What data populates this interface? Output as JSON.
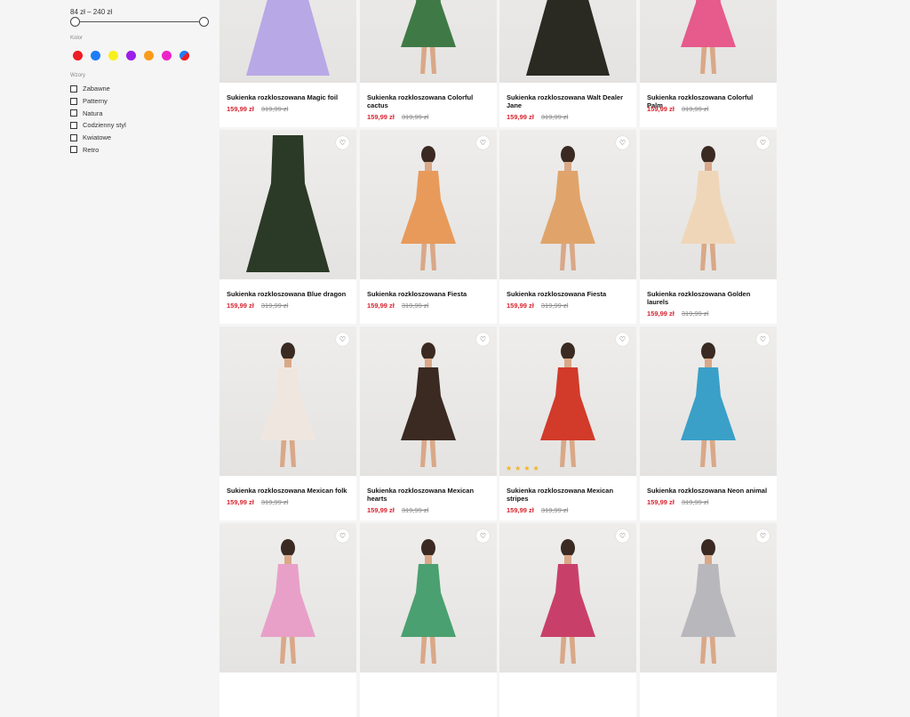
{
  "filters": {
    "price_range": "84 zł – 240 zł",
    "price_min_fraction": 0,
    "price_max_fraction": 1,
    "color_label": "Kolor",
    "colors": [
      "#ee1c24",
      "#1e7df5",
      "#f8f01c",
      "#9a1fe8",
      "#f99b1c",
      "#ee22c8",
      "#1e7df5/#ee1c24"
    ],
    "patterns_label": "Wzory",
    "patterns": [
      "Zabawne",
      "Patterny",
      "Natura",
      "Codzienny styl",
      "Kwiatowe",
      "Retro"
    ]
  },
  "products": [
    {
      "title": "Sukienka rozkloszowana Magic foil",
      "price": "159,99 zł",
      "old_price": "319,99 zł",
      "dress_color": "#b8a8e6"
    },
    {
      "title": "Sukienka rozkloszowana Colorful cactus",
      "price": "159,99 zł",
      "old_price": "319,99 zł",
      "dress_color": "#3f7a46"
    },
    {
      "title": "Sukienka rozkloszowana Walt Dealer Jane",
      "price": "159,99 zł",
      "old_price": "319,99 zł",
      "dress_color": "#2a2a22"
    },
    {
      "title": "Sukienka rozkloszowana Colorful Palm",
      "price": "159,99 zł",
      "old_price": "319,99 zł",
      "dress_color": "#e65a8c"
    },
    {
      "title": "Sukienka rozkloszowana Blue dragon",
      "price": "159,99 zł",
      "old_price": "319,99 zł",
      "dress_color": "#2b3a26"
    },
    {
      "title": "Sukienka rozkloszowana Fiesta",
      "price": "159,99 zł",
      "old_price": "319,99 zł",
      "dress_color": "#e89a5a"
    },
    {
      "title": "Sukienka rozkloszowana Fiesta",
      "price": "159,99 zł",
      "old_price": "319,99 zł",
      "dress_color": "#e0a46a"
    },
    {
      "title": "Sukienka rozkloszowana Golden laurels",
      "price": "159,99 zł",
      "old_price": "319,99 zł",
      "dress_color": "#f0d6b8"
    },
    {
      "title": "Sukienka rozkloszowana Mexican folk",
      "price": "159,99 zł",
      "old_price": "319,99 zł",
      "dress_color": "#f0e6e0"
    },
    {
      "title": "Sukienka rozkloszowana Mexican hearts",
      "price": "159,99 zł",
      "old_price": "319,99 zł",
      "dress_color": "#3a2a22"
    },
    {
      "title": "Sukienka rozkloszowana Mexican stripes",
      "price": "159,99 zł",
      "old_price": "319,99 zł",
      "dress_color": "#d23a2a",
      "rating_stars": 4
    },
    {
      "title": "Sukienka rozkloszowana Neon animal",
      "price": "159,99 zł",
      "old_price": "319,99 zł",
      "dress_color": "#3aa0c8"
    },
    {
      "dress_color": "#e8a0c8"
    },
    {
      "dress_color": "#4aa070"
    },
    {
      "dress_color": "#c8406a"
    },
    {
      "dress_color": "#b8b8bc"
    }
  ],
  "icons": {
    "favorite": "heart-icon",
    "rating": "star-icon"
  }
}
